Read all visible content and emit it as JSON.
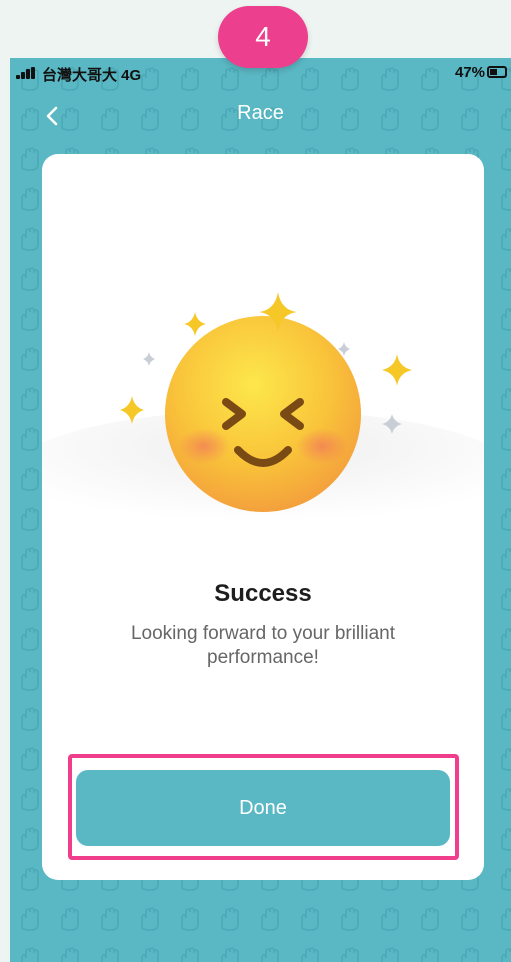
{
  "status_bar": {
    "carrier": "台灣大哥大  4G",
    "battery_percent": "47%",
    "battery_level": 0.47
  },
  "nav": {
    "title": "Race",
    "back_icon": "chevron-left-icon"
  },
  "card": {
    "illustration_icon": "smiling-face-with-sparkles",
    "title": "Success",
    "message": "Looking forward to your brilliant performance!",
    "done_label": "Done"
  },
  "annotation": {
    "step_number": "4"
  },
  "colors": {
    "background": "#5ab8c4",
    "button": "#5ab8c4",
    "highlight": "#f03e8c",
    "badge": "#ec3f8e",
    "sparkle_gold": "#f5c727",
    "sparkle_grey": "#c9ced6"
  }
}
